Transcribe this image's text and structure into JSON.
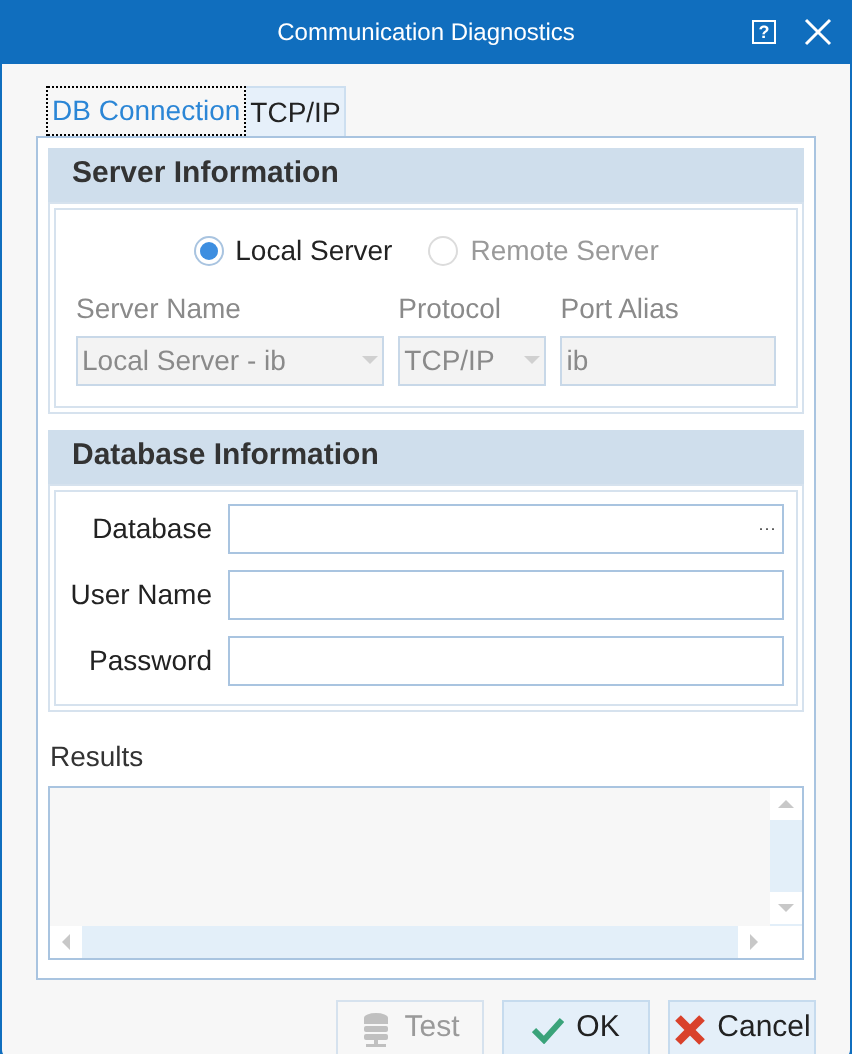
{
  "window": {
    "title": "Communication Diagnostics",
    "help_glyph": "?"
  },
  "tabs": [
    {
      "label": "DB Connection",
      "selected": true
    },
    {
      "label": "TCP/IP",
      "selected": false
    }
  ],
  "server_information": {
    "heading": "Server Information",
    "options": [
      {
        "label": "Local Server",
        "selected": true,
        "disabled": false
      },
      {
        "label": "Remote Server",
        "selected": false,
        "disabled": true
      }
    ],
    "fields": [
      {
        "label": "Server Name",
        "value": "Local Server - ib",
        "kind": "dropdown",
        "disabled": true
      },
      {
        "label": "Protocol",
        "value": "TCP/IP",
        "kind": "dropdown",
        "disabled": true
      },
      {
        "label": "Port Alias",
        "value": "ib",
        "kind": "text",
        "disabled": true
      }
    ]
  },
  "database_information": {
    "heading": "Database Information",
    "fields": [
      {
        "label": "Database",
        "kind": "browse",
        "browse_glyph": "···"
      },
      {
        "label": "User Name",
        "kind": "text"
      },
      {
        "label": "Password",
        "kind": "text"
      }
    ]
  },
  "results": {
    "label": "Results"
  },
  "buttons": [
    {
      "label": "Test",
      "kind": "test",
      "disabled": true
    },
    {
      "label": "OK",
      "kind": "ok",
      "disabled": false
    },
    {
      "label": "Cancel",
      "kind": "cancel",
      "disabled": false
    }
  ]
}
